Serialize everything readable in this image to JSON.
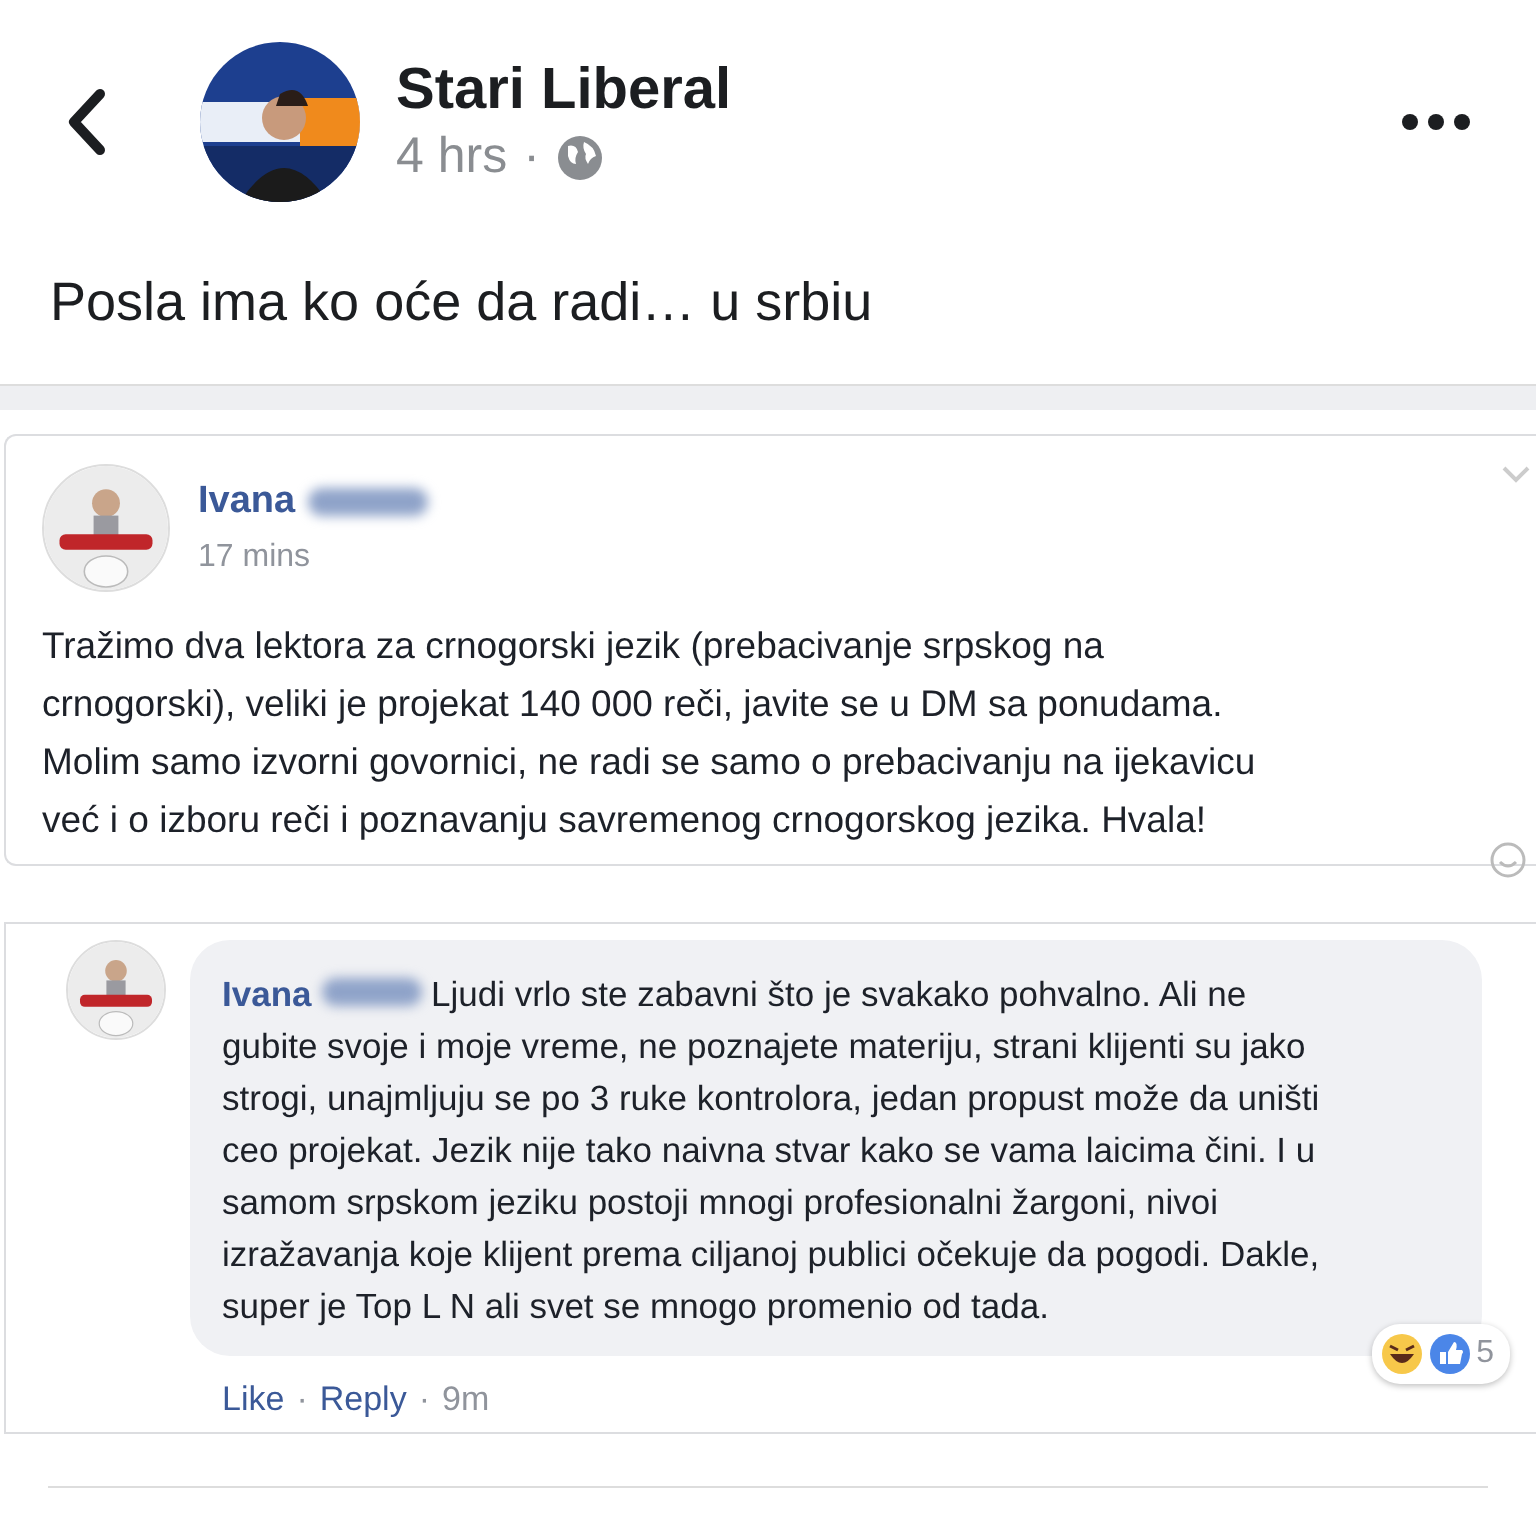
{
  "header": {
    "page_name": "Stari Liberal",
    "time": "4 hrs",
    "separator": "·"
  },
  "post": {
    "text": "Posla ima ko oće da radi… u srbiu"
  },
  "shared_post": {
    "author": "Ivana",
    "time": "17 mins",
    "text": "Tražimo dva lektora za crnogorski jezik (prebacivanje srpskog na crnogorski), veliki je projekat 140 000 reči, javite se u DM sa ponudama. Molim samo izvorni govornici, ne radi se samo o prebacivanju na ijekavicu već i o izboru reči i poznavanju savremenog crnogorskog jezika. Hvala!"
  },
  "comment": {
    "author": "Ivana",
    "text": "Ljudi vrlo ste zabavni što je svakako pohvalno. Ali ne gubite svoje i moje vreme, ne poznajete materiju, strani klijenti su jako strogi, unajmljuju se po 3 ruke kontrolora, jedan propust može da uništi ceo projekat. Jezik nije tako naivna stvar kako se vama laicima čini. I u samom srpskom jeziku postoji mnogi profesionalni žargoni, nivoi izražavanja koje klijent prema ciljanoj publici očekuje da pogodi. Dakle, super je Top L N ali svet se mnogo promenio od tada.",
    "actions": [
      {
        "label": "Like"
      },
      {
        "label": "Reply"
      }
    ],
    "separator": "·",
    "time": "9m",
    "reaction_count": "5"
  }
}
